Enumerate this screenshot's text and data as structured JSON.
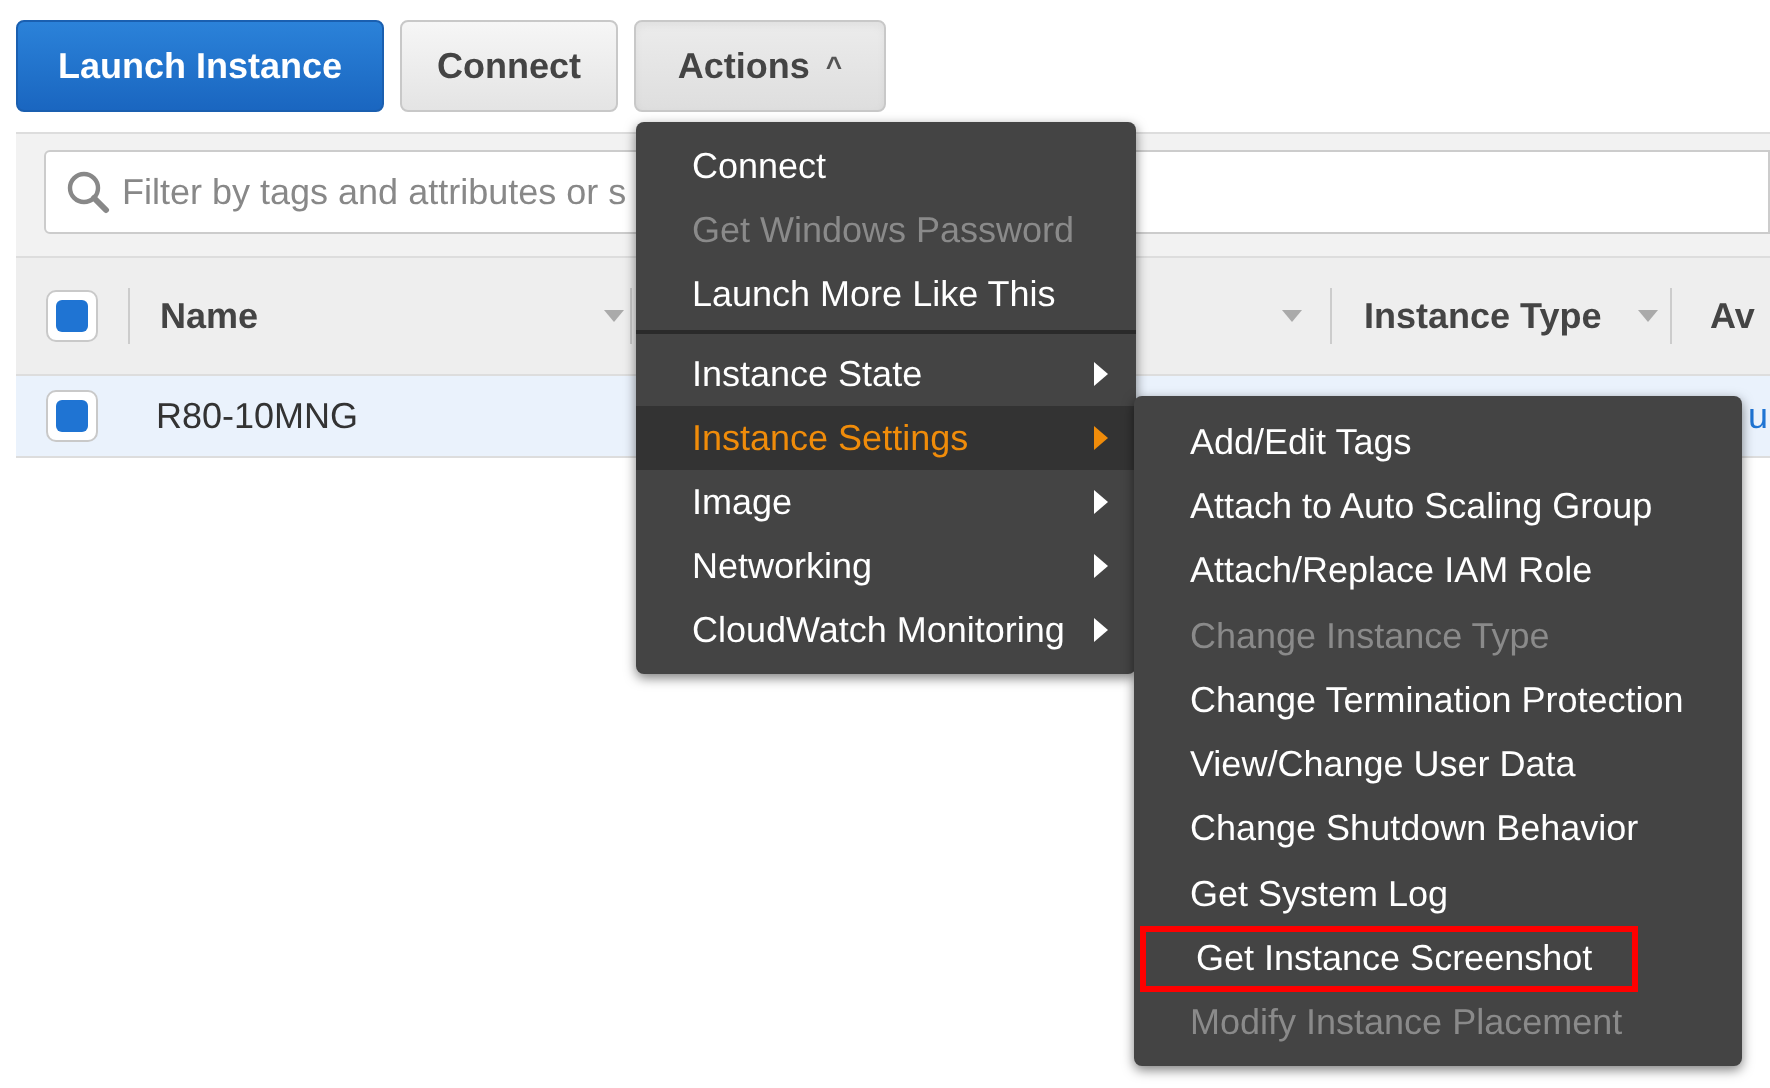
{
  "toolbar": {
    "buttons": [
      {
        "label": "Launch Instance",
        "kind": "primary"
      },
      {
        "label": "Connect",
        "kind": "default"
      },
      {
        "label": "Actions",
        "kind": "dropdown",
        "expanded": true,
        "caret": "^"
      }
    ]
  },
  "search": {
    "placeholder": "Filter by tags and attributes or s"
  },
  "table": {
    "select_all": {
      "checked": true
    },
    "columns": [
      {
        "label": "Name"
      },
      {
        "label": "Instance Type"
      },
      {
        "label": "Av"
      }
    ],
    "rows": [
      {
        "checked": true,
        "selected": true,
        "cells": [
          "R80-10MNG",
          "u"
        ]
      }
    ]
  },
  "actions_menu": {
    "groups": [
      [
        {
          "label": "Connect",
          "disabled": false,
          "submenu": false,
          "selected": false
        },
        {
          "label": "Get Windows Password",
          "disabled": true,
          "submenu": false,
          "selected": false
        },
        {
          "label": "Launch More Like This",
          "disabled": false,
          "submenu": false,
          "selected": false
        }
      ],
      [
        {
          "label": "Instance State",
          "disabled": false,
          "submenu": true,
          "selected": false
        },
        {
          "label": "Instance Settings",
          "disabled": false,
          "submenu": true,
          "selected": true
        },
        {
          "label": "Image",
          "disabled": false,
          "submenu": true,
          "selected": false
        },
        {
          "label": "Networking",
          "disabled": false,
          "submenu": true,
          "selected": false
        },
        {
          "label": "CloudWatch Monitoring",
          "disabled": false,
          "submenu": true,
          "selected": false
        }
      ]
    ]
  },
  "settings_submenu": {
    "items": [
      {
        "label": "Add/Edit Tags",
        "disabled": false,
        "outlined": false
      },
      {
        "label": "Attach to Auto Scaling Group",
        "disabled": false,
        "outlined": false
      },
      {
        "label": "Attach/Replace IAM Role",
        "disabled": false,
        "outlined": false
      },
      {
        "label": "Change Instance Type",
        "disabled": true,
        "outlined": false
      },
      {
        "label": "Change Termination Protection",
        "disabled": false,
        "outlined": false
      },
      {
        "label": "View/Change User Data",
        "disabled": false,
        "outlined": false
      },
      {
        "label": "Change Shutdown Behavior",
        "disabled": false,
        "outlined": false
      },
      {
        "label": "Get System Log",
        "disabled": false,
        "outlined": false
      },
      {
        "label": "Get Instance Screenshot",
        "disabled": false,
        "outlined": true
      },
      {
        "label": "Modify Instance Placement",
        "disabled": true,
        "outlined": false
      }
    ]
  }
}
